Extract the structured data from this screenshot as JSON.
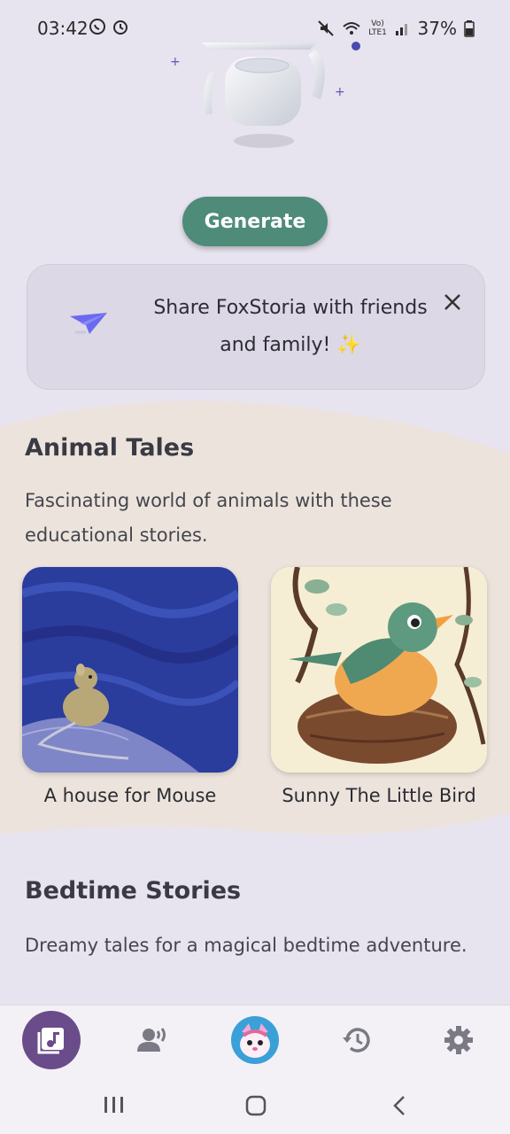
{
  "status_bar": {
    "time": "03:42",
    "battery": "37%",
    "icons": [
      "whatsapp-icon",
      "alarm-icon",
      "mute-icon",
      "wifi-icon",
      "volte-icon",
      "signal-icon",
      "battery-icon"
    ],
    "volte_label": "Vo) LTE1"
  },
  "hero": {
    "icon": "robot-illustration"
  },
  "generate_label": "Generate",
  "share_card": {
    "text": "Share FoxStoria with friends and family! ✨",
    "icon": "paper-plane-icon"
  },
  "sections": [
    {
      "title": "Animal Tales",
      "description": "Fascinating world of animals with these educational stories.",
      "stories": [
        {
          "title": "A house for Mouse"
        },
        {
          "title": "Sunny The Little Bird"
        }
      ]
    },
    {
      "title": "Bedtime Stories",
      "description": "Dreamy tales for a magical bedtime adventure."
    }
  ],
  "bottom_nav": [
    "library-icon",
    "voice-icon",
    "fox-avatar",
    "history-icon",
    "settings-icon"
  ],
  "colors": {
    "accent": "#4e8b79",
    "nav_active": "#6a4c8a",
    "background": "#e7e3ef",
    "section_bg": "#ece4dc"
  }
}
